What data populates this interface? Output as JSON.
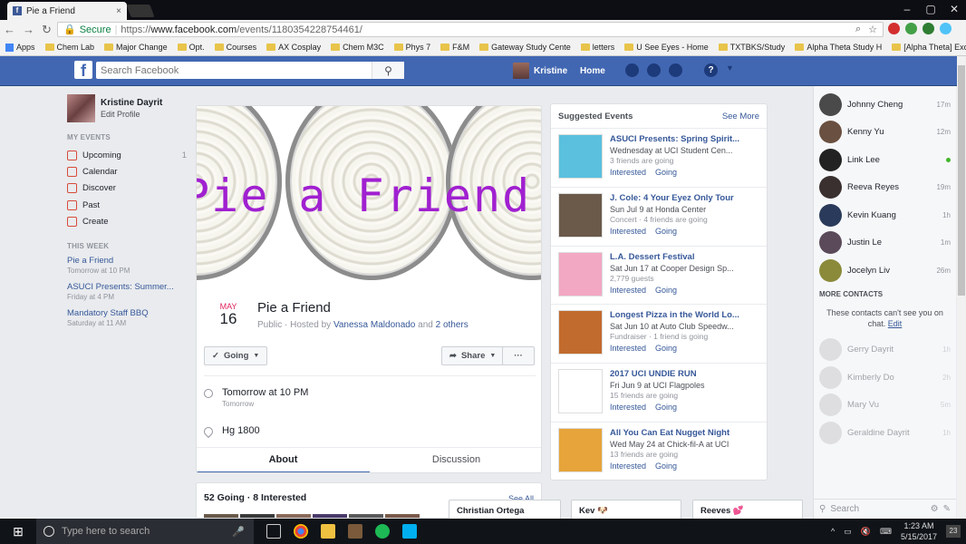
{
  "browser": {
    "tab_title": "Pie a Friend",
    "tab_favicon": "f",
    "secure_label": "Secure",
    "url_scheme": "https://",
    "url_host": "www.facebook.com",
    "url_path": "/events/1180354228754461/",
    "bookmarks": [
      "Apps",
      "Chem Lab",
      "Major Change",
      "Opt.",
      "Courses",
      "AX Cosplay",
      "Chem M3C",
      "Phys 7",
      "F&M",
      "Gateway Study Cente",
      "letters",
      "U See Eyes - Home",
      "TXTBKS/Study",
      "Alpha Theta Study H",
      "[Alpha Theta] Excom"
    ]
  },
  "fb_header": {
    "logo": "f",
    "search_placeholder": "Search Facebook",
    "user_name": "Kristine",
    "home_label": "Home",
    "help_icon": "?"
  },
  "left": {
    "profile_name": "Kristine Dayrit",
    "edit_profile": "Edit Profile",
    "my_events_header": "MY EVENTS",
    "nav": [
      {
        "label": "Upcoming",
        "count": "1",
        "icon": "calendar-icon"
      },
      {
        "label": "Calendar",
        "count": "",
        "icon": "calendar-icon"
      },
      {
        "label": "Discover",
        "count": "",
        "icon": "compass-icon"
      },
      {
        "label": "Past",
        "count": "",
        "icon": "clock-icon"
      },
      {
        "label": "Create",
        "count": "",
        "icon": "plus-icon"
      }
    ],
    "this_week_header": "THIS WEEK",
    "this_week": [
      {
        "title": "Pie a Friend",
        "when": "Tomorrow at 10 PM"
      },
      {
        "title": "ASUCI Presents: Summer...",
        "when": "Friday at 4 PM"
      },
      {
        "title": "Mandatory Staff BBQ",
        "when": "Saturday at 11 AM"
      }
    ]
  },
  "event": {
    "cover_text": "Pie a Friend",
    "month": "MAY",
    "day": "16",
    "title": "Pie a Friend",
    "public_hosted_by": "Public · Hosted by",
    "host": "Vanessa Maldonado",
    "and": "and",
    "others": "2 others",
    "going_btn": "Going",
    "share_btn": "Share",
    "more_btn": "···",
    "time": "Tomorrow at 10 PM",
    "time_sub": "Tomorrow",
    "location": "Hg 1800",
    "tab_about": "About",
    "tab_discussion": "Discussion",
    "going_count": "52 Going · 8 Interested",
    "see_all": "See All"
  },
  "suggested": {
    "header": "Suggested Events",
    "see_more": "See More",
    "items": [
      {
        "title": "ASUCI Presents: Spring Spirit...",
        "line1": "Wednesday at UCI Student Cen...",
        "line2": "3 friends are going",
        "thumb": "#5bc0de"
      },
      {
        "title": "J. Cole: 4 Your Eyez Only Tour",
        "line1": "Sun Jul 9 at Honda Center",
        "line2": "Concert · 4 friends are going",
        "thumb": "#6b5a4a"
      },
      {
        "title": "L.A. Dessert Festival",
        "line1": "Sat Jun 17 at Cooper Design Sp...",
        "line2": "2,779 guests",
        "thumb": "#f2a7c3"
      },
      {
        "title": "Longest Pizza in the World Lo...",
        "line1": "Sat Jun 10 at Auto Club Speedw...",
        "line2": "Fundraiser · 1 friend is going",
        "thumb": "#c26b2e"
      },
      {
        "title": "2017 UCI UNDIE RUN",
        "line1": "Fri Jun 9 at UCI Flagpoles",
        "line2": "15 friends are going",
        "thumb": "#ffffff"
      },
      {
        "title": "All You Can Eat Nugget Night",
        "line1": "Wed May 24 at Chick-fil-A at UCI",
        "line2": "13 friends are going",
        "thumb": "#e6a43a"
      }
    ],
    "interested": "Interested",
    "going": "Going"
  },
  "chat": {
    "contacts": [
      {
        "name": "Johnny Cheng",
        "time": "17m",
        "color": "#4a4a4a"
      },
      {
        "name": "Kenny Yu",
        "time": "12m",
        "color": "#6a5040"
      },
      {
        "name": "Link Lee",
        "time": "",
        "color": "#222222",
        "online": true
      },
      {
        "name": "Reeva Reyes",
        "time": "19m",
        "color": "#3a3030"
      },
      {
        "name": "Kevin Kuang",
        "time": "1h",
        "color": "#2a3a5a"
      },
      {
        "name": "Justin Le",
        "time": "1m",
        "color": "#5a4a5a"
      },
      {
        "name": "Jocelyn Liv",
        "time": "26m",
        "color": "#8a8a3a"
      }
    ],
    "more_contacts": "MORE CONTACTS",
    "note": "These contacts can't see you on chat.",
    "edit": "Edit",
    "offline": [
      {
        "name": "Gerry Dayrit",
        "time": "1h"
      },
      {
        "name": "Kimberly Do",
        "time": "2h"
      },
      {
        "name": "Mary Vu",
        "time": "5m"
      },
      {
        "name": "Geraldine Dayrit",
        "time": "1h"
      }
    ],
    "search_placeholder": "Search",
    "tabs": [
      "Christian Ortega",
      "Kev 🐶",
      "Reeves 💕"
    ]
  },
  "taskbar": {
    "search_placeholder": "Type here to search",
    "time": "1:23 AM",
    "date": "5/15/2017",
    "notif_count": "23"
  }
}
